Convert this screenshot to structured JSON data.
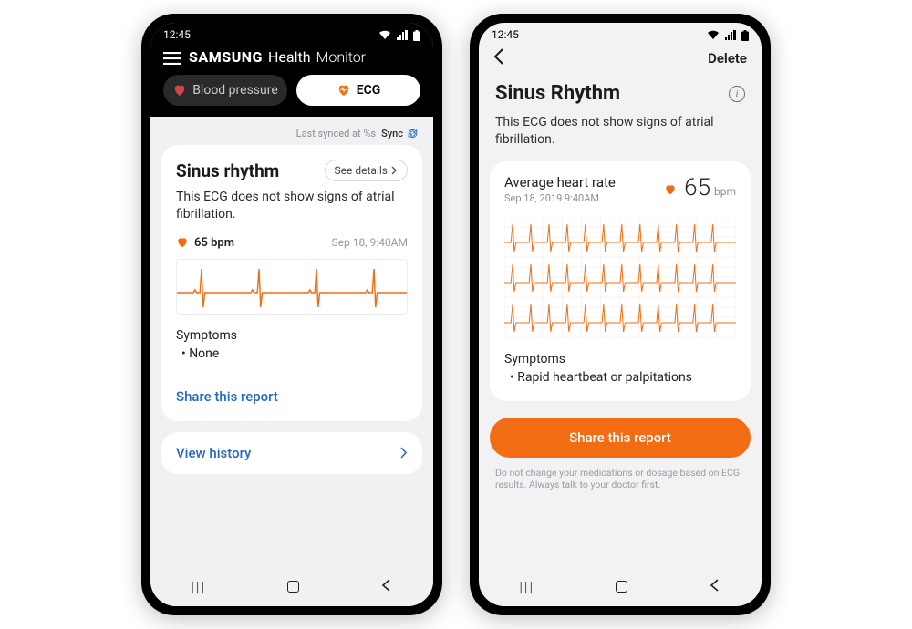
{
  "status_time": "12:45",
  "phone1": {
    "app_brand": "SAMSUNG",
    "app_sub": "Health",
    "app_sub2": "Monitor",
    "tab_bp": "Blood pressure",
    "tab_ecg": "ECG",
    "last_synced_label": "Last synced at %s",
    "sync_label": "Sync",
    "card": {
      "title": "Sinus rhythm",
      "see_details": "See details",
      "description": "This ECG does not show signs of atrial fibrillation.",
      "heart_rate": "65 bpm",
      "timestamp": "Sep 18, 9:40AM",
      "symptoms_label": "Symptoms",
      "symptom_0": "•  None",
      "share_label": "Share this report"
    },
    "view_history": "View history"
  },
  "phone2": {
    "delete_label": "Delete",
    "title": "Sinus Rhythm",
    "description": "This ECG does not show signs of atrial fibrillation.",
    "avg_label": "Average heart rate",
    "avg_date": "Sep 18, 2019 9:40AM",
    "avg_value": "65",
    "avg_unit": "bpm",
    "symptoms_label": "Symptoms",
    "symptom_0": "•  Rapid heartbeat or palpitations",
    "primary_btn": "Share this report",
    "disclaimer": "Do not change your medications or dosage based on ECG results. Always talk to your doctor first."
  }
}
